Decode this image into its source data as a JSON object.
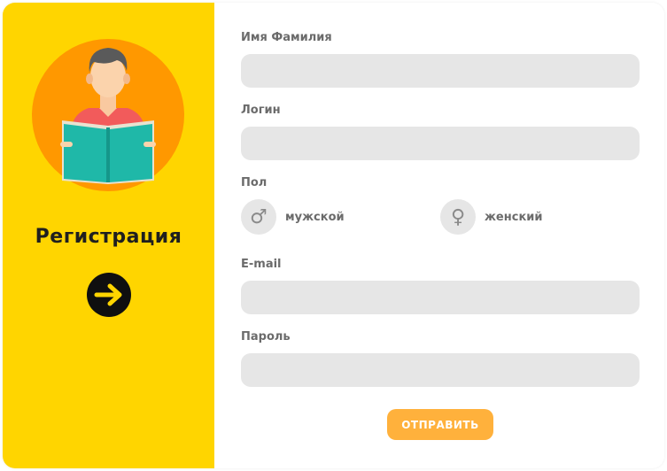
{
  "sidebar": {
    "title": "Регистрация",
    "avatar_icon": "reader-with-book-icon",
    "next_icon": "arrow-right-icon",
    "accent_color": "#FFD500"
  },
  "form": {
    "name_label": "Имя Фамилия",
    "name_value": "",
    "login_label": "Логин",
    "login_value": "",
    "gender_label": "Пол",
    "gender_options": [
      {
        "label": "мужской",
        "symbol": "♂",
        "icon": "male-symbol-icon"
      },
      {
        "label": "женский",
        "symbol": "♀",
        "icon": "female-symbol-icon"
      }
    ],
    "email_label": "Е-mail",
    "email_value": "",
    "password_label": "Пароль",
    "password_value": "",
    "submit_label": "ОТПРАВИТЬ",
    "submit_color": "#FFB13C"
  }
}
